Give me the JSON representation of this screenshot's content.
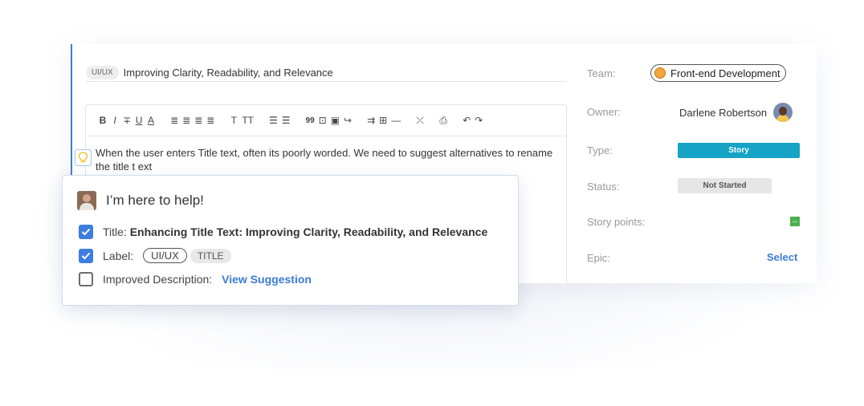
{
  "title": {
    "tag": "UI/UX",
    "text": "Improving Clarity, Readability, and Relevance"
  },
  "toolbar": {
    "bold": "B",
    "italic": "I",
    "strike": "∓",
    "underline": "U",
    "color": "A",
    "align_left": "≣",
    "align_center": "≣",
    "align_right": "≣",
    "justify": "≣",
    "text_size": "T",
    "text_size_large": "TT",
    "bullets": "☰",
    "numbered": "☰",
    "quote": "99",
    "code": "⊡",
    "image": "▣",
    "link": "↪",
    "wrap": "⇉",
    "table": "⊞",
    "hr": "—",
    "clear_format": "⤫",
    "attach": "⎙",
    "undo": "↶",
    "redo": "↷"
  },
  "editor": {
    "text": "When the user enters Title text, often its poorly worded. We need to suggest alternatives to rename the title t ext"
  },
  "popup": {
    "heading": "I’m here to help!",
    "title_label": "Title:",
    "title_value": "Enhancing Title Text: Improving Clarity, Readability, and Relevance",
    "label_label": "Label:",
    "label_chips": [
      "UI/UX",
      "TITLE"
    ],
    "desc_label": "Improved Description:",
    "desc_link": "View Suggestion",
    "checked": [
      true,
      true,
      false
    ]
  },
  "panel": {
    "team_label": "Team:",
    "team_value": "Front-end Development",
    "owner_label": "Owner:",
    "owner_value": "Darlene Robertson",
    "type_label": "Type:",
    "type_value": "Story",
    "status_label": "Status:",
    "status_value": "Not Started",
    "points_label": "Story points:",
    "points_value": "--",
    "epic_label": "Epic:",
    "epic_value": "Select"
  },
  "colors": {
    "accent": "#3a7bd5",
    "type_badge": "#15a3c6",
    "points": "#4caf50",
    "status_bg": "#e6e6e6"
  }
}
